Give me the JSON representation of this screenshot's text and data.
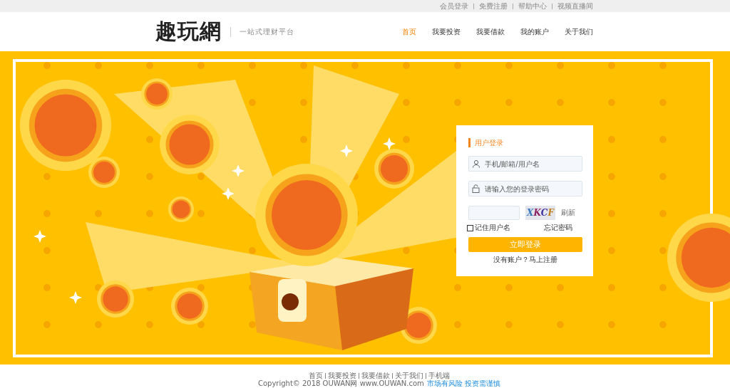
{
  "top_links": [
    "会员登录",
    "免费注册",
    "帮助中心",
    "视频直播间"
  ],
  "header": {
    "logo": "趣玩網",
    "slogan": "一站式理财平台",
    "nav": [
      {
        "label": "首页",
        "selected": true
      },
      {
        "label": "我要投资",
        "selected": false
      },
      {
        "label": "我要借款",
        "selected": false
      },
      {
        "label": "我的账户",
        "selected": false
      },
      {
        "label": "关于我们",
        "selected": false
      }
    ]
  },
  "login": {
    "title": "用户登录",
    "fields": [
      {
        "kind": "user",
        "placeholder": "手机/邮箱/用户名"
      },
      {
        "kind": "lock",
        "placeholder": "请输入您的登录密码"
      }
    ],
    "captcha_text": "XKCF",
    "refresh": "刷新",
    "remember": {
      "label": "记住用户名",
      "checked": false
    },
    "forgot": "忘记密码",
    "submit": "立即登录",
    "no_account": "没有账户？",
    "register": "马上注册"
  },
  "footer": {
    "links": [
      "首页",
      "我要投资",
      "我要借款",
      "关于我们",
      "手机端"
    ],
    "copyright": "Copyright© 2018 OUWAN网 www.OUWAN.com",
    "warning": "市场有风险 投资需谨慎"
  }
}
